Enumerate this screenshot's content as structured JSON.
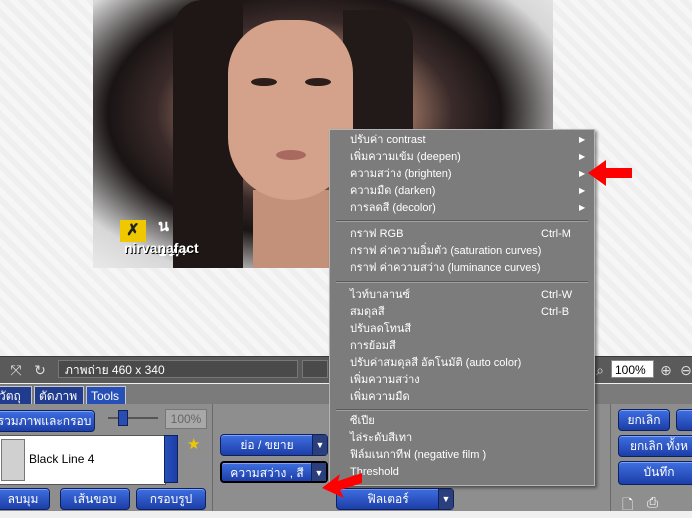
{
  "image": {
    "watermark_digits": "๑๓+",
    "watermark_text": "nirvanafact",
    "watermark_char": "น"
  },
  "status": {
    "info": "ภาพถ่าย 460 x 340",
    "zoom": "100%"
  },
  "tabs": [
    "วัตถุ",
    "ตัดภาพ",
    "Tools"
  ],
  "panel": {
    "merge_button": "รวมภาพและกรอบ",
    "slider_value": "100%",
    "preset_name": "Black Line 4",
    "round_corner": "ลบมุม",
    "border_line": "เส้นขอบ",
    "frame": "กรอบรูป",
    "resize": "ย่อ / ขยาย",
    "brightness_color": "ความสว่าง , สี",
    "filter": "ฟิลเตอร์",
    "cancel": "ยกเลิก",
    "cancel_all": "ยกเลิก ทั้งห",
    "save": "บันทึก"
  },
  "menu": {
    "group1": [
      {
        "label": "ปรับค่า contrast"
      },
      {
        "label": "เพิ่มความเข้ม (deepen)"
      },
      {
        "label": "ความสว่าง (brighten)"
      },
      {
        "label": "ความมืด (darken)"
      },
      {
        "label": "การลดสี (decolor)"
      }
    ],
    "group2": [
      {
        "label": "กราฟ RGB",
        "shortcut": "Ctrl-M"
      },
      {
        "label": "กราฟ ค่าความอิ่มตัว (saturation curves)"
      },
      {
        "label": "กราฟ ค่าความสว่าง (luminance curves)"
      }
    ],
    "group3": [
      {
        "label": "ไวท์บาลานซ์",
        "shortcut": "Ctrl-W"
      },
      {
        "label": "สมดุลสี",
        "shortcut": "Ctrl-B"
      },
      {
        "label": "ปรับลดโทนสี"
      },
      {
        "label": "การย้อมสี"
      },
      {
        "label": "ปรับค่าสมดุลสี อัตโนมัติ (auto color)"
      },
      {
        "label": "เพิ่มความสว่าง"
      },
      {
        "label": "เพิ่มความมืด"
      }
    ],
    "group4": [
      {
        "label": "ซีเปีย"
      },
      {
        "label": "ไล่ระดับสีเทา"
      },
      {
        "label": "ฟิล์มเนกาทีฟ (negative film )"
      },
      {
        "label": "Threshold"
      }
    ]
  },
  "colors": {
    "accent": "#1c3ea8",
    "menu_bg": "#7c7c7c",
    "arrow": "#ff0000"
  }
}
